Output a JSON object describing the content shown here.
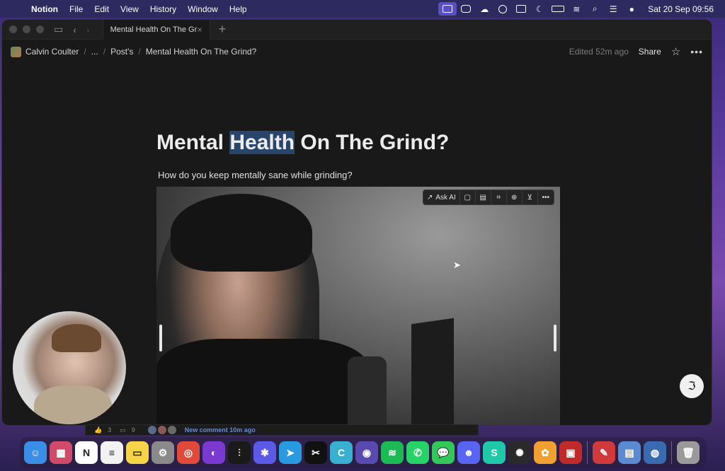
{
  "menubar": {
    "app_name": "Notion",
    "menus": [
      "File",
      "Edit",
      "View",
      "History",
      "Window",
      "Help"
    ],
    "clock": "Sat 20 Sep  09:56"
  },
  "tabbar": {
    "tab_title": "Mental Health On The Gri...",
    "close_glyph": "×",
    "new_tab_glyph": "+"
  },
  "breadcrumb": {
    "workspace": "Calvin Coulter",
    "ellipsis": "...",
    "parent": "Post's",
    "current": "Mental Health On The Grind?"
  },
  "topbar": {
    "edited": "Edited 52m ago",
    "share": "Share"
  },
  "page": {
    "title_pre": "Mental ",
    "title_hl": "Health",
    "title_post": " On The Grind?",
    "subtitle": "How do you keep mentally sane while grinding?"
  },
  "image_toolbar": {
    "ask_ai": "Ask AI"
  },
  "comments": {
    "likes": "3",
    "comments": "9",
    "new_comment": "New comment 10m ago"
  },
  "dock": {
    "apps": [
      {
        "name": "finder-icon",
        "color": "#3a8ee6",
        "glyph": "☺"
      },
      {
        "name": "launchpad-icon",
        "color": "#d04a6a",
        "glyph": "▦"
      },
      {
        "name": "notion-icon",
        "color": "#ffffff",
        "glyph": "N"
      },
      {
        "name": "reminders-icon",
        "color": "#f2f2f2",
        "glyph": "≡"
      },
      {
        "name": "notes-icon",
        "color": "#f5d547",
        "glyph": "▭"
      },
      {
        "name": "system-settings-icon",
        "color": "#8a8a8a",
        "glyph": "⚙"
      },
      {
        "name": "chrome-icon",
        "color": "#e04a3a",
        "glyph": "◎"
      },
      {
        "name": "arc-icon",
        "color": "#7a3ad0",
        "glyph": "◐"
      },
      {
        "name": "voice-memos-icon",
        "color": "#1a1a1a",
        "glyph": "⫶"
      },
      {
        "name": "perplexity-icon",
        "color": "#5a5ae6",
        "glyph": "✱"
      },
      {
        "name": "telegram-icon",
        "color": "#2a9ae0",
        "glyph": "➤"
      },
      {
        "name": "capcut-icon",
        "color": "#111111",
        "glyph": "✂"
      },
      {
        "name": "canva-icon",
        "color": "#3ab0d0",
        "glyph": "C"
      },
      {
        "name": "proton-vpn-icon",
        "color": "#5a4ab0",
        "glyph": "◉"
      },
      {
        "name": "spotify-icon",
        "color": "#1db954",
        "glyph": "≋"
      },
      {
        "name": "whatsapp-icon",
        "color": "#25d366",
        "glyph": "✆"
      },
      {
        "name": "messages-icon",
        "color": "#34c759",
        "glyph": "💬"
      },
      {
        "name": "discord-icon",
        "color": "#5865f2",
        "glyph": "☻"
      },
      {
        "name": "surfshark-icon",
        "color": "#1ec8a8",
        "glyph": "S"
      },
      {
        "name": "chatgpt-icon",
        "color": "#2a2a2a",
        "glyph": "✺"
      },
      {
        "name": "photos-icon",
        "color": "#f0a030",
        "glyph": "✿"
      },
      {
        "name": "photo-booth-icon",
        "color": "#c02a2a",
        "glyph": "▣"
      },
      {
        "name": "quill-icon",
        "color": "#d03a3a",
        "glyph": "✎"
      },
      {
        "name": "preview-icon",
        "color": "#5a8ad0",
        "glyph": "▤"
      },
      {
        "name": "quicktime-icon",
        "color": "#3a6ab0",
        "glyph": "◍"
      },
      {
        "name": "trash-icon",
        "color": "#9a9a9a",
        "glyph": "🗑"
      }
    ]
  }
}
